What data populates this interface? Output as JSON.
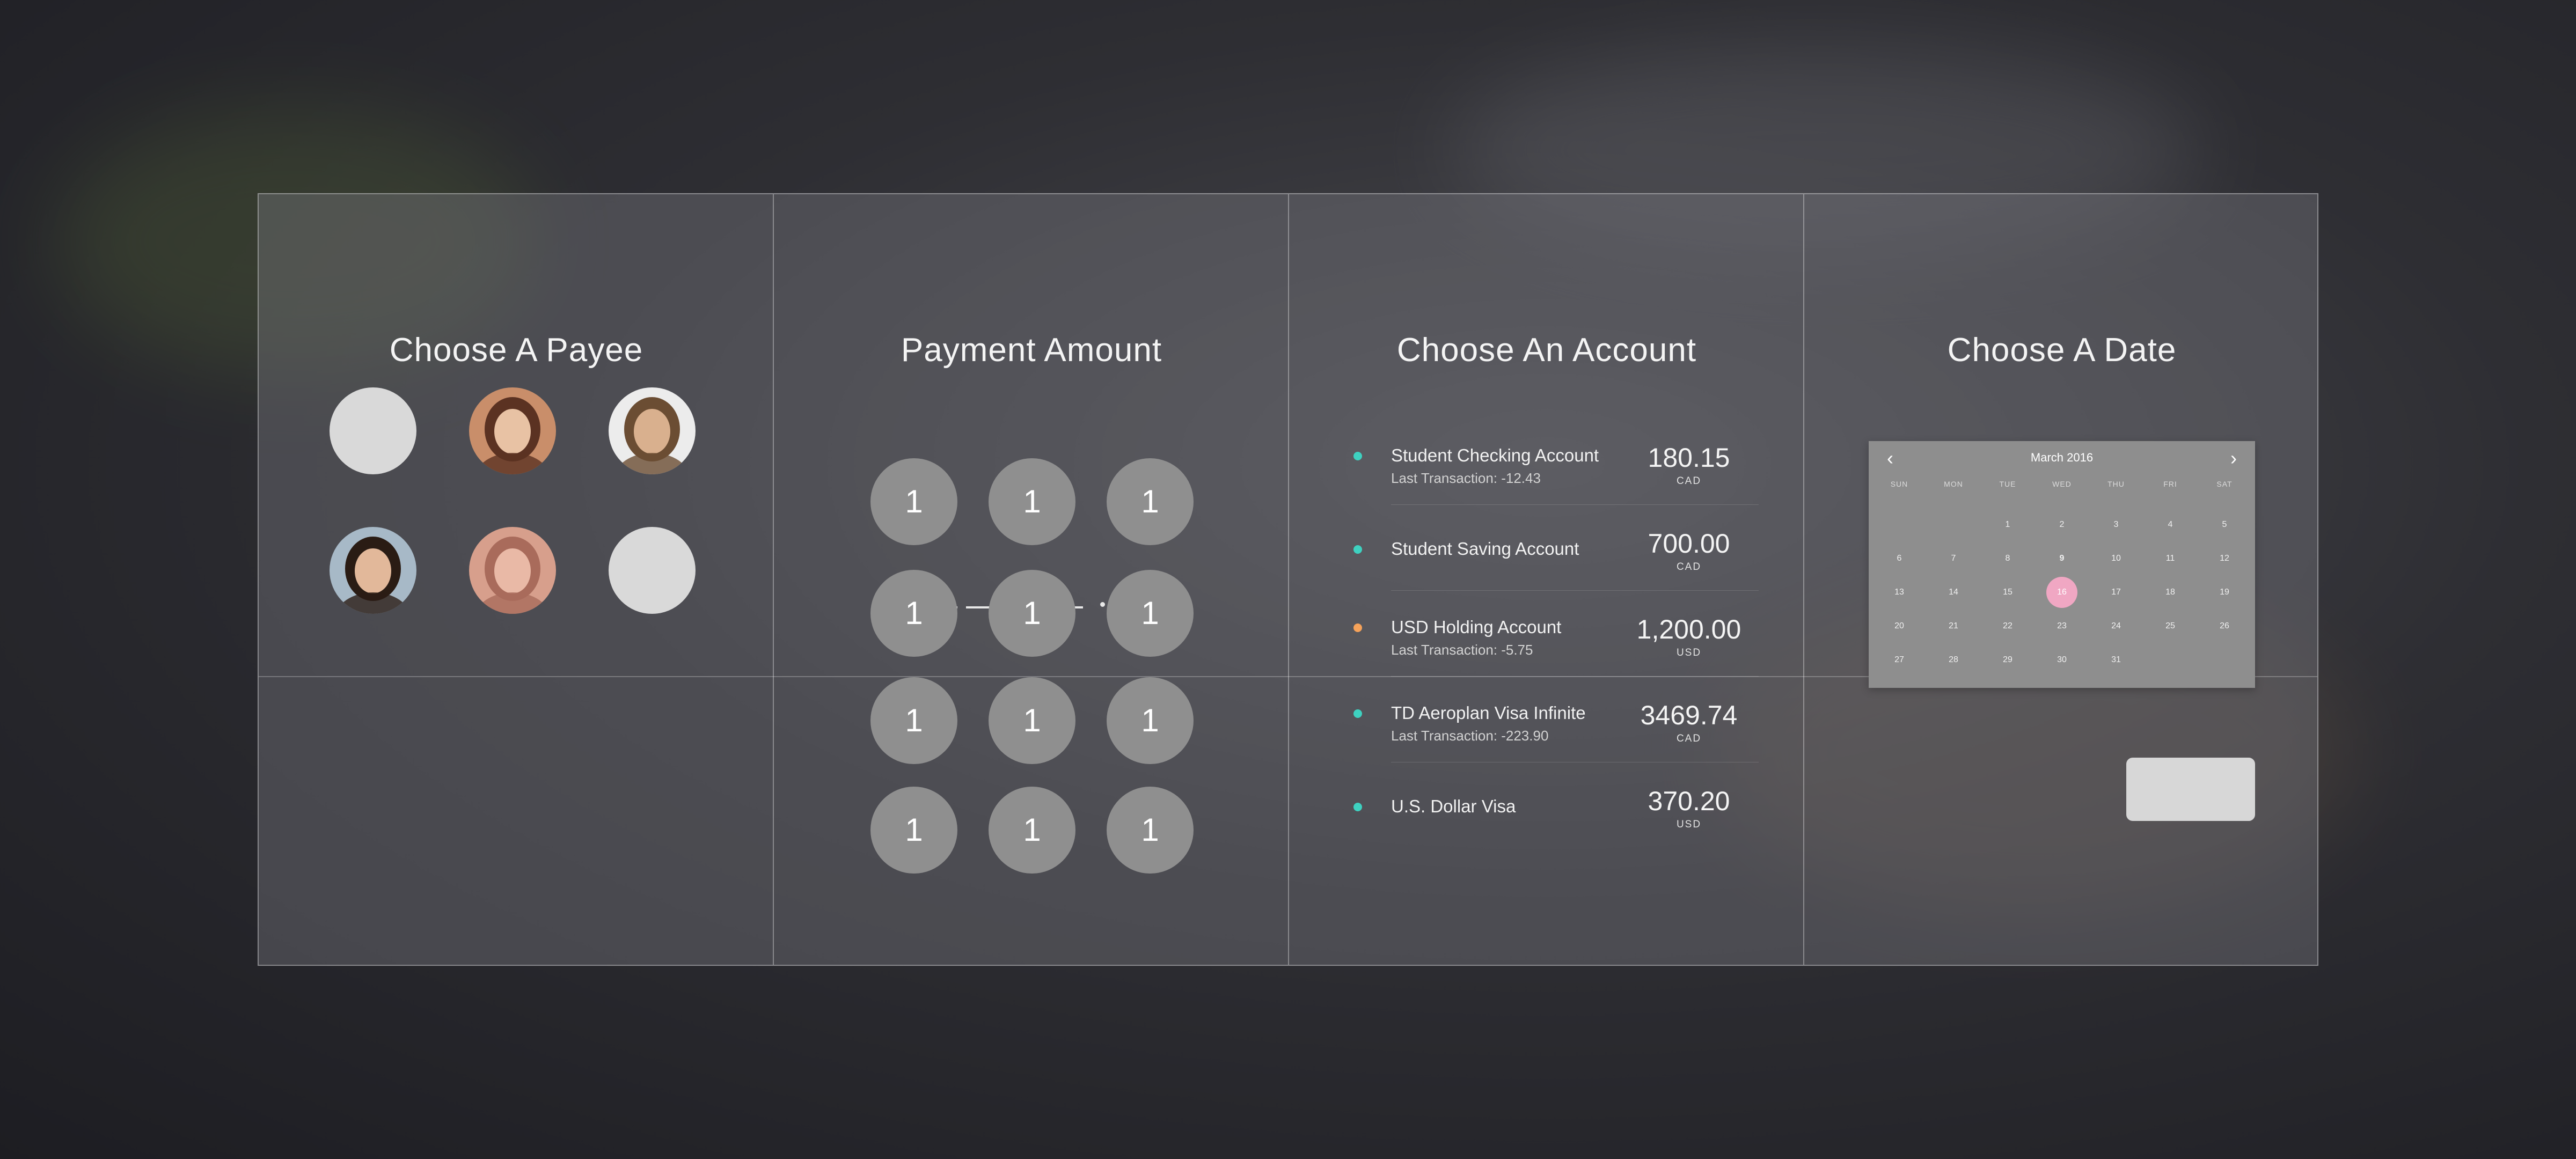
{
  "payee": {
    "title": "Choose A Payee",
    "avatars": [
      {
        "kind": "placeholder"
      },
      {
        "kind": "photo",
        "palette": [
          "#c98e6a",
          "#5b3222",
          "#e8c2a4"
        ]
      },
      {
        "kind": "photo",
        "palette": [
          "#ececec",
          "#6b4d33",
          "#d9b08e"
        ]
      },
      {
        "kind": "photo",
        "palette": [
          "#a7b9c7",
          "#2a1c14",
          "#e2b89a"
        ]
      },
      {
        "kind": "photo",
        "palette": [
          "#d79f8c",
          "#a96b5b",
          "#e9b9a6"
        ]
      },
      {
        "kind": "placeholder"
      }
    ]
  },
  "payment": {
    "title": "Payment Amount",
    "keys": [
      "1",
      "1",
      "1",
      "1",
      "1",
      "1",
      "1",
      "1",
      "1",
      "1",
      "1",
      "1"
    ]
  },
  "account": {
    "title": "Choose An Account",
    "items": [
      {
        "name": "Student Checking Account",
        "sub": "Last Transaction: -12.43",
        "amount": "180.15",
        "currency": "CAD",
        "dot": "#3ed1c0"
      },
      {
        "name": "Student Saving Account",
        "sub": "",
        "amount": "700.00",
        "currency": "CAD",
        "dot": "#3ed1c0"
      },
      {
        "name": "USD Holding Account",
        "sub": "Last Transaction: -5.75",
        "amount": "1,200.00",
        "currency": "USD",
        "dot": "#f5a25a"
      },
      {
        "name": "TD Aeroplan Visa Infinite",
        "sub": "Last Transaction: -223.90",
        "amount": "3469.74",
        "currency": "CAD",
        "dot": "#3ed1c0"
      },
      {
        "name": "U.S. Dollar Visa",
        "sub": "",
        "amount": "370.20",
        "currency": "USD",
        "dot": "#3ed1c0"
      }
    ]
  },
  "date": {
    "title": "Choose A Date",
    "month": "March 2016",
    "weekdays": [
      "SUN",
      "MON",
      "TUE",
      "WED",
      "THU",
      "FRI",
      "SAT"
    ],
    "weeks": [
      [
        "",
        "",
        "1",
        "2",
        "3",
        "4",
        "5"
      ],
      [
        "6",
        "7",
        "8",
        "9",
        "10",
        "11",
        "12"
      ],
      [
        "13",
        "14",
        "15",
        "16",
        "17",
        "18",
        "19"
      ],
      [
        "20",
        "21",
        "22",
        "23",
        "24",
        "25",
        "26"
      ],
      [
        "27",
        "28",
        "29",
        "30",
        "31",
        "",
        ""
      ]
    ],
    "today": "9",
    "selected": "16",
    "selected_color": "#f0a7c3"
  }
}
